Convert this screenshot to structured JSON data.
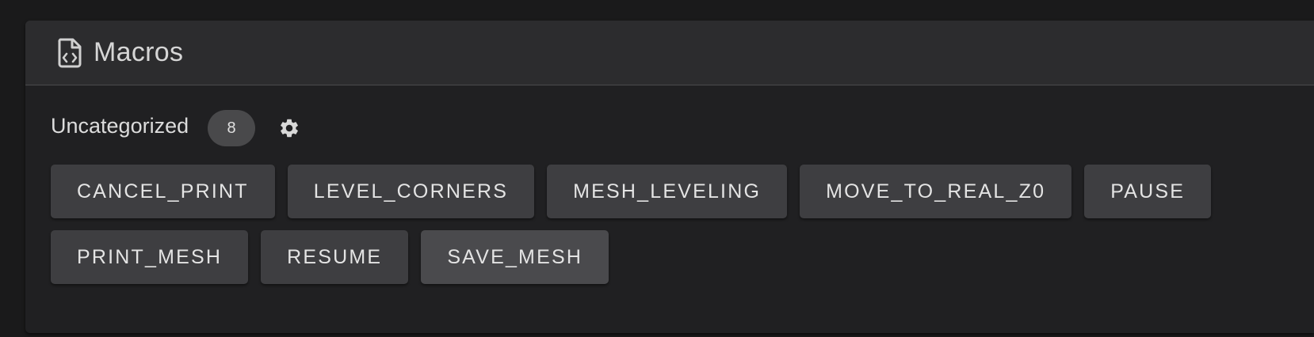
{
  "panel": {
    "title": "Macros",
    "icon": "file-code-icon"
  },
  "category": {
    "label": "Uncategorized",
    "count": "8",
    "settings_icon": "gear-icon"
  },
  "macros": [
    "CANCEL_PRINT",
    "LEVEL_CORNERS",
    "MESH_LEVELING",
    "MOVE_TO_REAL_Z0",
    "PAUSE",
    "PRINT_MESH",
    "RESUME",
    "SAVE_MESH"
  ],
  "colors": {
    "background": "#1a1a1b",
    "card": "#202022",
    "header": "#2c2c2e",
    "button": "#3e3e41",
    "text": "#e4e4e4"
  }
}
